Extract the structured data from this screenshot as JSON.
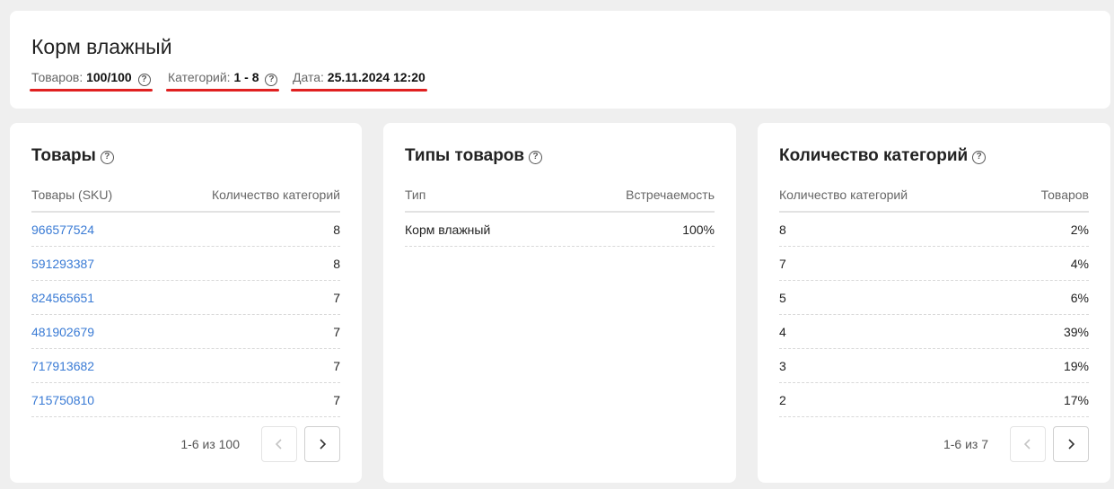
{
  "header": {
    "title": "Корм влажный",
    "stats": [
      {
        "label": "Товаров:",
        "value": "100/100",
        "help": "?"
      },
      {
        "label": "Категорий:",
        "value": "1 - 8",
        "help": "?"
      },
      {
        "label": "Дата:",
        "value": "25.11.2024 12:20"
      }
    ]
  },
  "products": {
    "title": "Товары",
    "help": "?",
    "columns": [
      "Товары (SKU)",
      "Количество категорий"
    ],
    "rows": [
      {
        "sku": "966577524",
        "count": "8"
      },
      {
        "sku": "591293387",
        "count": "8"
      },
      {
        "sku": "824565651",
        "count": "7"
      },
      {
        "sku": "481902679",
        "count": "7"
      },
      {
        "sku": "717913682",
        "count": "7"
      },
      {
        "sku": "715750810",
        "count": "7"
      }
    ],
    "pager": {
      "label": "1-6 из 100",
      "prev_disabled": true
    }
  },
  "types": {
    "title": "Типы товаров",
    "help": "?",
    "columns": [
      "Тип",
      "Встречаемость"
    ],
    "rows": [
      {
        "type": "Корм влажный",
        "share": "100%"
      }
    ]
  },
  "categories": {
    "title": "Количество категорий",
    "help": "?",
    "columns": [
      "Количество категорий",
      "Товаров"
    ],
    "rows": [
      {
        "count": "8",
        "share": "2%"
      },
      {
        "count": "7",
        "share": "4%"
      },
      {
        "count": "5",
        "share": "6%"
      },
      {
        "count": "4",
        "share": "39%"
      },
      {
        "count": "3",
        "share": "19%"
      },
      {
        "count": "2",
        "share": "17%"
      }
    ],
    "pager": {
      "label": "1-6 из 7",
      "prev_disabled": true
    }
  },
  "icons": {
    "prev": "chevron-left-icon",
    "next": "chevron-right-icon",
    "help": "question-circle-icon"
  },
  "colors": {
    "accent_underline": "#e02020",
    "link": "#3a7bd5"
  }
}
